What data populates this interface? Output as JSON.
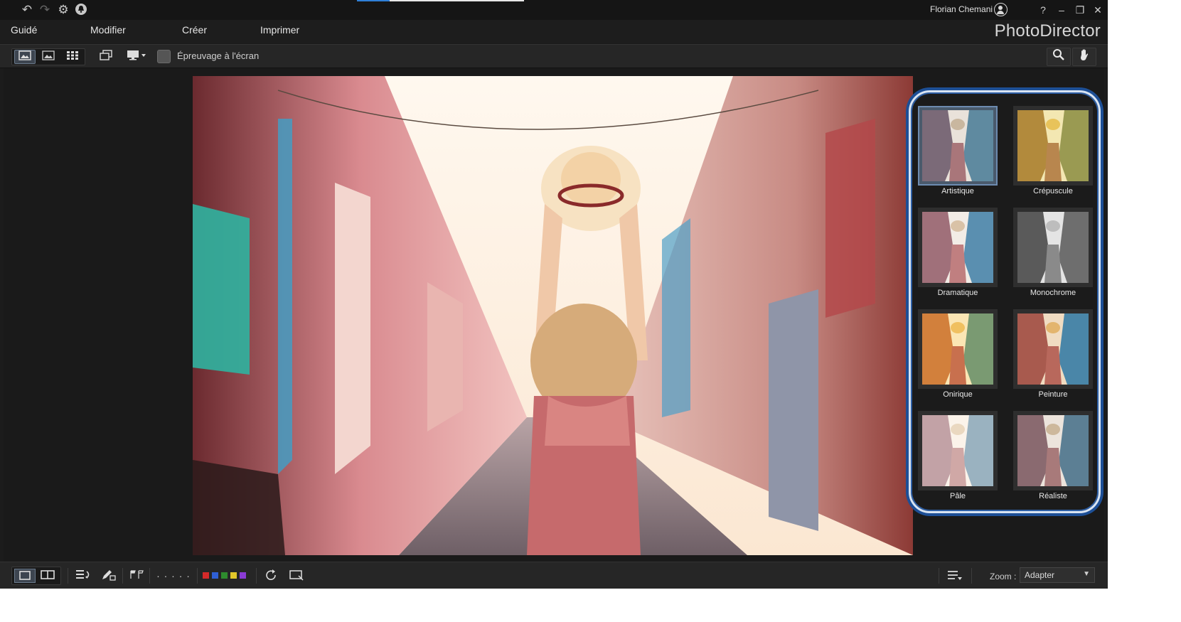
{
  "titlebar": {
    "user_name": "Florian Chemani",
    "help": "?",
    "minimize": "–",
    "restore": "❐",
    "close": "✕"
  },
  "menu": {
    "items": [
      "Guidé",
      "Modifier",
      "Créer",
      "Imprimer"
    ],
    "brand": "PhotoDirector"
  },
  "toolbar": {
    "proof_label": "Épreuvage à l'écran"
  },
  "presets": [
    {
      "label": "Artistique",
      "selected": true,
      "tone": "#b7a89a"
    },
    {
      "label": "Crépuscule",
      "selected": false,
      "tone": "#d8b45a"
    },
    {
      "label": "Dramatique",
      "selected": false,
      "tone": "#b99a95"
    },
    {
      "label": "Monochrome",
      "selected": false,
      "tone": "#9a9a9a"
    },
    {
      "label": "Onirique",
      "selected": false,
      "tone": "#e0a24a"
    },
    {
      "label": "Peinture",
      "selected": false,
      "tone": "#c89a6a"
    },
    {
      "label": "Pâle",
      "selected": false,
      "tone": "#d9c6b8"
    },
    {
      "label": "Réaliste",
      "selected": false,
      "tone": "#b0a7a0"
    }
  ],
  "bottombar": {
    "zoom_label": "Zoom :",
    "zoom_value": "Adapter",
    "rating_dots": "· · · · ·",
    "label_colors": [
      "#d42a2a",
      "#2f5fd4",
      "#2e8b2e",
      "#e2c62a",
      "#8a3bd4"
    ]
  },
  "colors": {
    "accent": "#2f7fd8",
    "panel_outline": "#1d4f96"
  }
}
